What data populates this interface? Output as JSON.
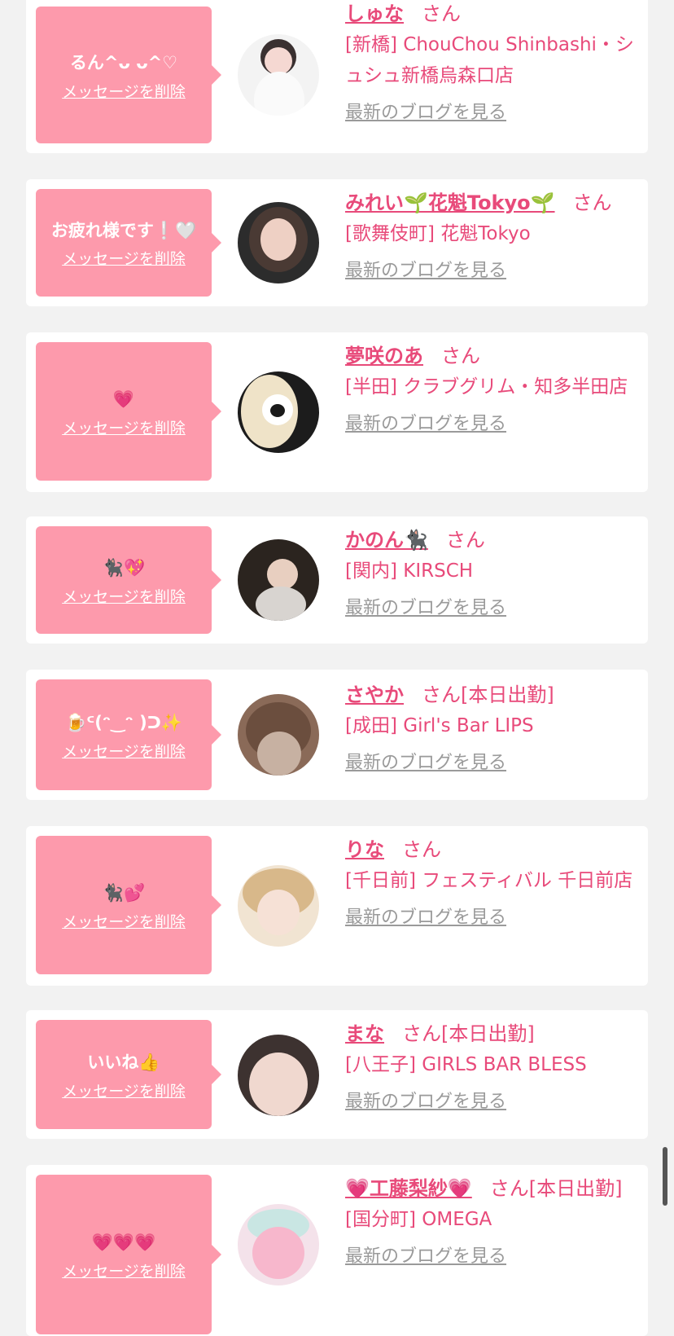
{
  "delete_label": "メッセージを削除",
  "blog_label": "最新のブログを見る",
  "san_label": "さん",
  "colors": {
    "accent": "#e84a7a",
    "bubble": "#fd9aac",
    "card": "#ffffff",
    "background": "#f2f2f2"
  },
  "items": [
    {
      "message": "るん^ᴗ ᴗ^♡",
      "name": "しゅな",
      "suffix": "",
      "shop": "[新橋] ChouChou Shinbashi・シュシュ新橋烏森口店"
    },
    {
      "message": "お疲れ様です❕🤍",
      "name": "みれい🌱花魁Tokyo🌱",
      "suffix": "",
      "shop": "[歌舞伎町] 花魁Tokyo"
    },
    {
      "message": "💗",
      "name": "夢咲のあ",
      "suffix": "",
      "shop": "[半田] クラブグリム・知多半田店"
    },
    {
      "message": "🐈‍⬛💖",
      "name": "かのん🐈‍⬛",
      "suffix": "",
      "shop": "[関内] KIRSCH"
    },
    {
      "message": "🍺ᑦ(ᵔ‿ᵔ )ᑐ✨",
      "name": "さやか",
      "suffix": "[本日出勤]",
      "shop": "[成田] Girl's Bar LIPS"
    },
    {
      "message": "🐈‍⬛💕",
      "name": "りな",
      "suffix": "",
      "shop": "[千日前] フェスティバル 千日前店"
    },
    {
      "message": "いいね👍",
      "name": "まな",
      "suffix": "[本日出勤]",
      "shop": "[八王子] GIRLS BAR BLESS"
    },
    {
      "message": "💗💗💗",
      "name": "💗工藤梨紗💗",
      "suffix": "[本日出勤]",
      "shop": "[国分町] OMEGA"
    }
  ]
}
